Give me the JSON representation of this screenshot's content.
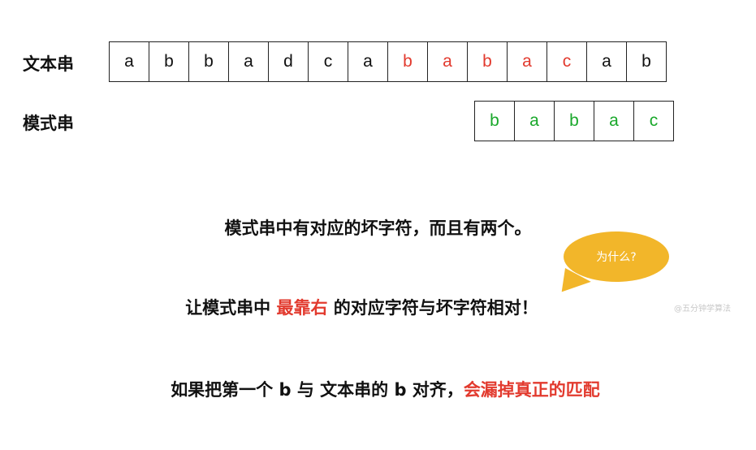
{
  "labels": {
    "text": "文本串",
    "pattern": "模式串"
  },
  "text_chars": [
    {
      "c": "a",
      "color": "black"
    },
    {
      "c": "b",
      "color": "black"
    },
    {
      "c": "b",
      "color": "black"
    },
    {
      "c": "a",
      "color": "black"
    },
    {
      "c": "d",
      "color": "black"
    },
    {
      "c": "c",
      "color": "black"
    },
    {
      "c": "a",
      "color": "black"
    },
    {
      "c": "b",
      "color": "red"
    },
    {
      "c": "a",
      "color": "red"
    },
    {
      "c": "b",
      "color": "red"
    },
    {
      "c": "a",
      "color": "red"
    },
    {
      "c": "c",
      "color": "red"
    },
    {
      "c": "a",
      "color": "black"
    },
    {
      "c": "b",
      "color": "black"
    }
  ],
  "pattern_chars": [
    {
      "c": "b",
      "color": "green"
    },
    {
      "c": "a",
      "color": "green"
    },
    {
      "c": "b",
      "color": "green"
    },
    {
      "c": "a",
      "color": "green"
    },
    {
      "c": "c",
      "color": "green"
    }
  ],
  "line1": "模式串中有对应的坏字符，而且有两个。",
  "line2": {
    "before": "让模式串中 ",
    "highlight": "最靠右",
    "after": " 的对应字符与坏字符相对！"
  },
  "line3": {
    "before": "如果把第一个 b 与 文本串的 b 对齐，",
    "highlight": "会漏掉真正的匹配"
  },
  "bubble_text": "为什么?",
  "watermark": "@五分钟学算法",
  "colors": {
    "red": "#e23a2e",
    "green": "#1aa82b",
    "bubble": "#f2b62a"
  }
}
